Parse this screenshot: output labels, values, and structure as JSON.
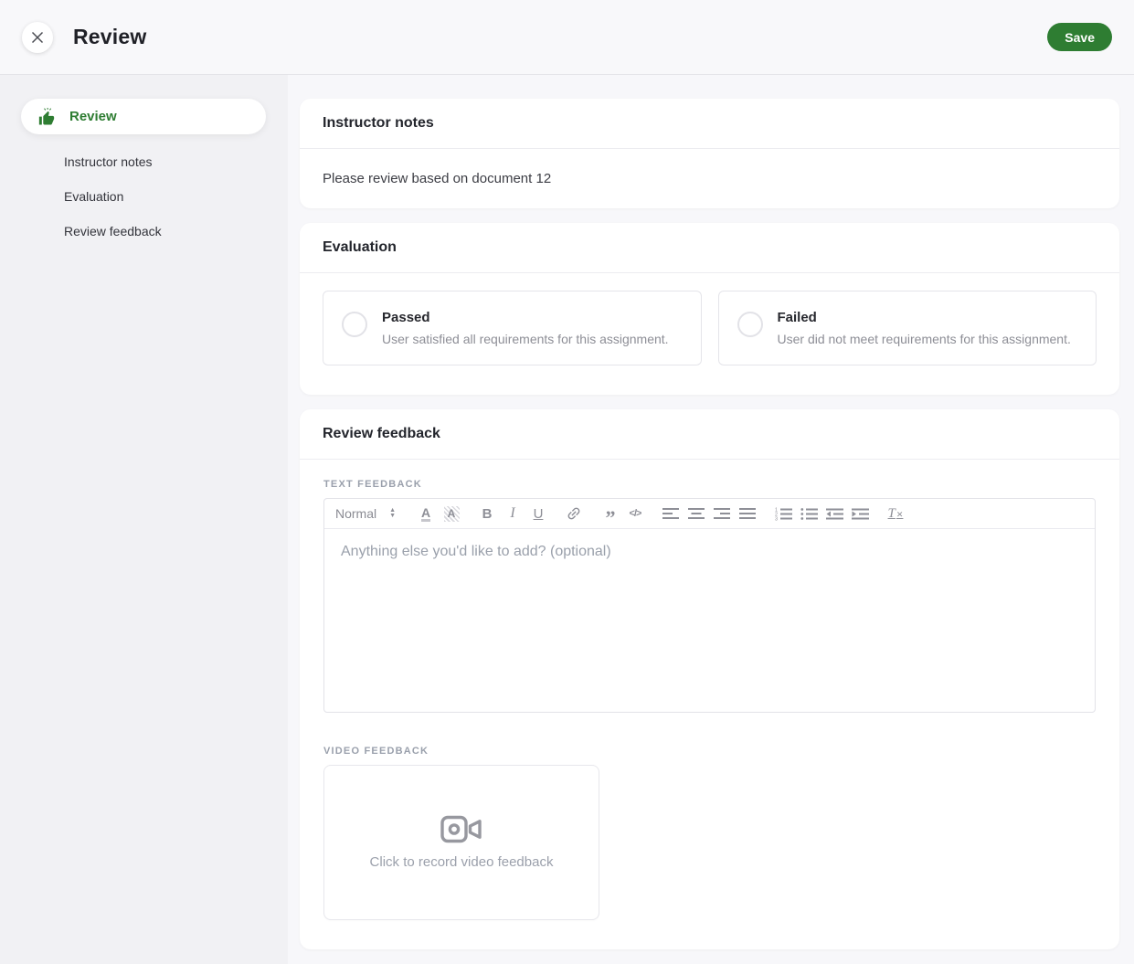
{
  "header": {
    "title": "Review",
    "save_label": "Save"
  },
  "sidebar": {
    "active_item": {
      "label": "Review",
      "icon": "thumbs-up-icon"
    },
    "items": [
      {
        "label": "Instructor notes"
      },
      {
        "label": "Evaluation"
      },
      {
        "label": "Review feedback"
      }
    ]
  },
  "instructor_notes": {
    "title": "Instructor notes",
    "body": "Please review based on document 12"
  },
  "evaluation": {
    "title": "Evaluation",
    "options": [
      {
        "label": "Passed",
        "description": "User satisfied all requirements for this assignment.",
        "selected": false
      },
      {
        "label": "Failed",
        "description": "User did not meet requirements for this assignment.",
        "selected": false
      }
    ]
  },
  "review_feedback": {
    "title": "Review feedback",
    "text_feedback_label": "TEXT FEEDBACK",
    "editor": {
      "format_selector_value": "Normal",
      "value": "",
      "placeholder": "Anything else you'd like to add? (optional)",
      "tools": [
        "format-paragraph-select",
        "text-color",
        "background-color",
        "bold",
        "italic",
        "underline",
        "link",
        "blockquote",
        "code-block",
        "align-left",
        "align-center",
        "align-right",
        "align-justify",
        "ordered-list",
        "bullet-list",
        "outdent",
        "indent",
        "clear-formatting"
      ]
    },
    "video_feedback_label": "VIDEO FEEDBACK",
    "video_prompt": "Click to record video feedback"
  },
  "colors": {
    "accent_green": "#2e7d32",
    "icon_gray": "#8e8f97"
  }
}
